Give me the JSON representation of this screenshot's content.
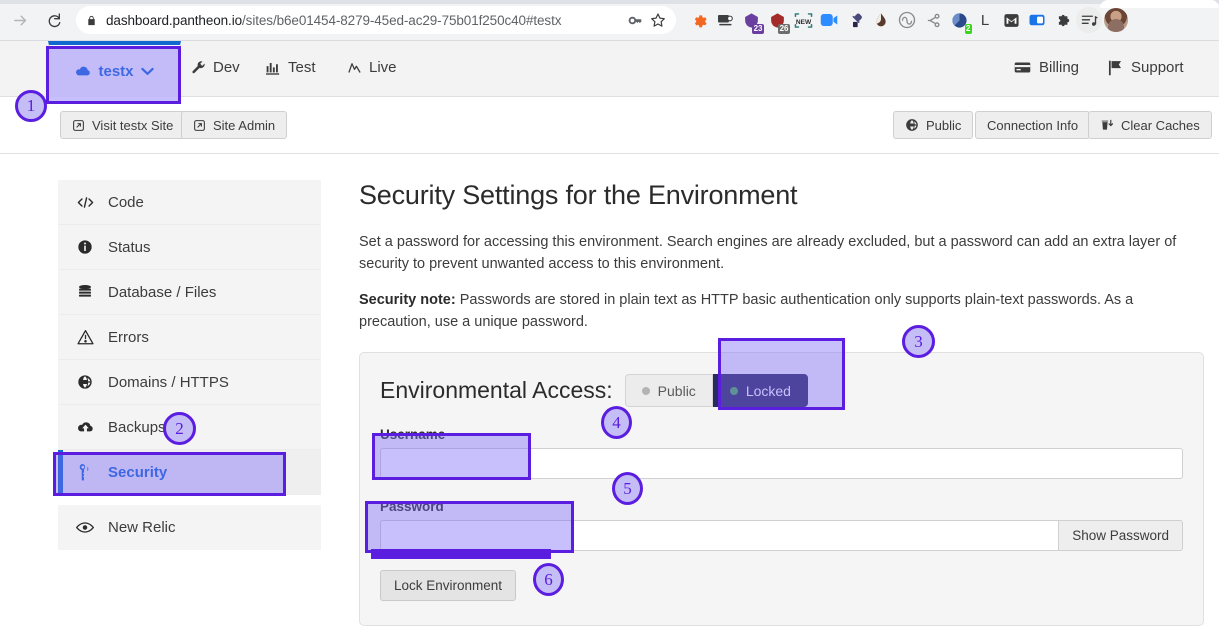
{
  "browser": {
    "url_prefix": "dashboard.pantheon.io",
    "url_suffix": "/sites/b6e01454-8279-45ed-ac29-75b01f250c40#testx",
    "forward_icon": "forward-arrow-icon",
    "reload_icon": "reload-icon",
    "lock_icon": "site-lock-icon",
    "key_icon": "password-key-icon",
    "star_icon": "bookmark-star-icon",
    "extensions": [
      {
        "name": "gear-extension-icon",
        "glyph": "⚙",
        "color": "#f26722",
        "badge": "",
        "badge_color": ""
      },
      {
        "name": "screencast-extension-icon",
        "glyph": "■",
        "color": "#3c4043",
        "badge": "",
        "badge_color": ""
      },
      {
        "name": "calendar-23-extension-icon",
        "glyph": "⬟",
        "color": "#6b3fa0",
        "badge": "23",
        "badge_color": "#6b3fa0"
      },
      {
        "name": "calendar-26-extension-icon",
        "glyph": "⬟",
        "color": "#a52a2a",
        "badge": "26",
        "badge_color": "#6d6d6d"
      },
      {
        "name": "new-capture-extension-icon",
        "glyph": "NEW",
        "color": "#2b7a78",
        "badge": "",
        "badge_color": ""
      },
      {
        "name": "zoom-extension-icon",
        "glyph": "▶",
        "color": "#2d8cff",
        "badge": "",
        "badge_color": ""
      },
      {
        "name": "eyedropper-extension-icon",
        "glyph": "✒",
        "color": "#3c3c6e",
        "badge": "",
        "badge_color": ""
      },
      {
        "name": "ink-drop-extension-icon",
        "glyph": "◗",
        "color": "#5a3a2e",
        "badge": "",
        "badge_color": ""
      },
      {
        "name": "wave-extension-icon",
        "glyph": "≈",
        "color": "#8a8a8a",
        "badge": "",
        "badge_color": ""
      },
      {
        "name": "hubspot-extension-icon",
        "glyph": "✂",
        "color": "#8a8a8a",
        "badge": "",
        "badge_color": ""
      },
      {
        "name": "pie-extension-icon",
        "glyph": "◔",
        "color": "#2b4a8b",
        "badge": "2",
        "badge_color": "#3bd41f"
      },
      {
        "name": "letter-l-extension-icon",
        "glyph": "L",
        "color": "#3c3c3c",
        "badge": "",
        "badge_color": ""
      },
      {
        "name": "gmail-extension-icon",
        "glyph": "M",
        "color": "#3c3c3c",
        "badge": "",
        "badge_color": ""
      },
      {
        "name": "sidebar-extension-icon",
        "glyph": "◧",
        "color": "#1a73e8",
        "badge": "",
        "badge_color": ""
      },
      {
        "name": "puzzle-extensions-icon",
        "glyph": "❖",
        "color": "#3c3c3c",
        "badge": "",
        "badge_color": ""
      },
      {
        "name": "media-list-icon",
        "glyph": "♫",
        "color": "#3c3c3c",
        "badge": "",
        "badge_color": ""
      }
    ]
  },
  "header": {
    "site_name": "testx",
    "site_icon": "cloud-icon",
    "dropdown_icon": "chevron-down-icon",
    "environments": [
      {
        "label": "Dev",
        "icon": "wrench-icon"
      },
      {
        "label": "Test",
        "icon": "bar-chart-icon"
      },
      {
        "label": "Live",
        "icon": "pulse-peak-icon"
      }
    ],
    "right_links": [
      {
        "label": "Billing",
        "icon": "credit-card-icon"
      },
      {
        "label": "Support",
        "icon": "flag-icon"
      }
    ]
  },
  "action_bar": {
    "visit_site": "Visit testx Site",
    "visit_site_icon": "external-link-icon",
    "site_admin": "Site Admin",
    "site_admin_icon": "external-link-icon",
    "public": "Public",
    "public_icon": "globe-icon",
    "connection_info": "Connection Info",
    "clear_caches": "Clear Caches",
    "clear_caches_icon": "trash-down-icon"
  },
  "sidebar": {
    "items": [
      {
        "label": "Code",
        "icon": "code-brackets-icon",
        "active": false
      },
      {
        "label": "Status",
        "icon": "info-circle-icon",
        "active": false
      },
      {
        "label": "Database / Files",
        "icon": "database-icon",
        "active": false
      },
      {
        "label": "Errors",
        "icon": "warning-triangle-icon",
        "active": false
      },
      {
        "label": "Domains / HTTPS",
        "icon": "globe-icon",
        "active": false
      },
      {
        "label": "Backups",
        "icon": "cloud-upload-icon",
        "active": false
      },
      {
        "label": "Security",
        "icon": "key-icon",
        "active": true
      },
      {
        "label": "New Relic",
        "icon": "eye-icon",
        "active": false
      }
    ]
  },
  "main": {
    "title": "Security Settings for the Environment",
    "paragraph1": "Set a password for accessing this environment. Search engines are already excluded, but a password can add an extra layer of security to prevent unwanted access to this environment.",
    "security_note_label": "Security note:",
    "security_note_body": " Passwords are stored in plain text as HTTP basic authentication only supports plain-text passwords. As a precaution, use a unique password.",
    "access_title": "Environmental Access:",
    "toggle": {
      "public_label": "Public",
      "locked_label": "Locked",
      "selected": "Locked",
      "public_dot_color": "#b3b3b3",
      "locked_dot_color": "#4caf50",
      "locked_bg_color": "#2b2a5e"
    },
    "username_label": "Username",
    "username_value": "",
    "password_label": "Password",
    "password_value": "",
    "show_password_label": "Show Password",
    "lock_environment_label": "Lock Environment"
  },
  "annotations": {
    "accent_color": "#5b1de0",
    "fill_color": "rgba(124,106,247,0.42)",
    "markers": [
      {
        "number": "1",
        "target": "site-tab"
      },
      {
        "number": "2",
        "target": "sidebar-item-security"
      },
      {
        "number": "3",
        "target": "locked-toggle"
      },
      {
        "number": "4",
        "target": "username-input"
      },
      {
        "number": "5",
        "target": "password-input"
      },
      {
        "number": "6",
        "target": "lock-environment-button"
      }
    ]
  }
}
